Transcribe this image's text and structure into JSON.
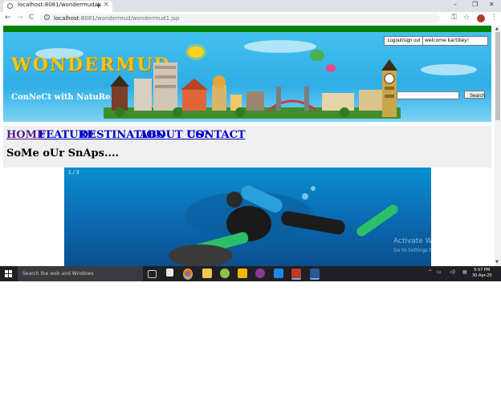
{
  "browser": {
    "tab_title": "localhost:8081/wondermud/wor",
    "tab_close": "×",
    "new_tab": "+",
    "window_controls": [
      "–",
      "❐",
      "✕"
    ],
    "nav": {
      "back": "←",
      "forward": "→",
      "reload": "C"
    },
    "url_host": "localhost",
    "url_rest": ":8081/wondermud/wondermud1.jsp",
    "toolbar_icons": [
      "key-icon",
      "star-icon",
      "avatar",
      "menu-icon"
    ],
    "star": "☆",
    "key": "⚿",
    "menu": "⋮"
  },
  "page": {
    "logo": "WONDERMUD",
    "tagline": "ConNeCt with NatuRe..",
    "logout_label": "Logout/sign out",
    "welcome_text": "welcome kartikey!",
    "search_button": "Search",
    "search_value": "",
    "nav_links": [
      {
        "label": "HOME",
        "visited": true
      },
      {
        "label": "FEATURE"
      },
      {
        "label": "DESTINATION"
      },
      {
        "label": "ABOUT US?"
      },
      {
        "label": "CONTACT"
      }
    ],
    "gallery_heading": "SoMe oUr SnAps....",
    "slide_counter": "1 / 3"
  },
  "os_overlay": {
    "activate_title": "Activate Windows",
    "activate_sub": "Go to Settings to activate Windows."
  },
  "taskbar": {
    "search_placeholder": "Search the web and Windows",
    "time": "5:57 PM",
    "date": "30-Apr-20",
    "apps": [
      "task-view-icon",
      "store-icon",
      "chrome-icon",
      "folder-icon",
      "paint-icon",
      "file-explorer-icon",
      "media-icon",
      "vscode-icon",
      "app-icon",
      "word-icon"
    ],
    "tray": {
      "chevron": "^",
      "network": "▭",
      "volume": "◁)",
      "notifications": "▤"
    }
  },
  "colors": {
    "green_bar": "#008000",
    "link": "#0000cc",
    "visited_link": "#551a8b",
    "logo": "#f4c515",
    "taskbar": "#1f2026"
  }
}
